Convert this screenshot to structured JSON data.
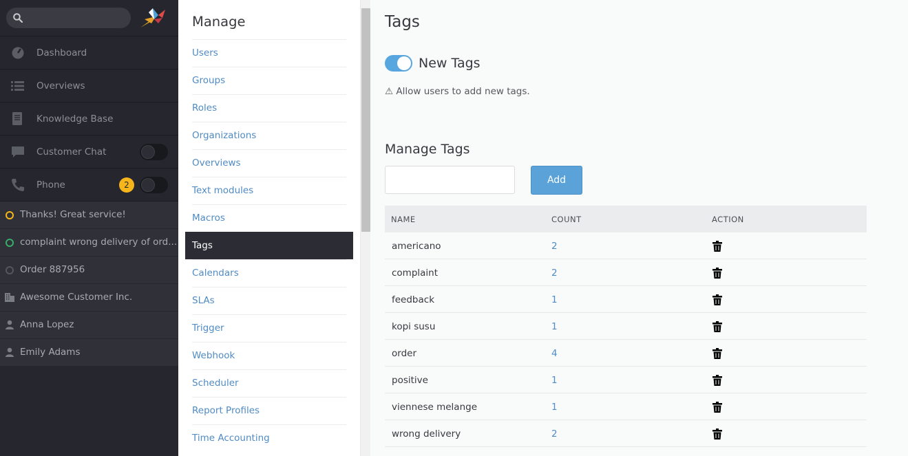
{
  "nav": {
    "items": [
      {
        "label": "Dashboard",
        "icon": "dashboard-icon"
      },
      {
        "label": "Overviews",
        "icon": "list-icon"
      },
      {
        "label": "Knowledge Base",
        "icon": "book-icon"
      },
      {
        "label": "Customer Chat",
        "icon": "chat-icon"
      },
      {
        "label": "Phone",
        "icon": "phone-icon",
        "badge": "2"
      }
    ],
    "tasks": [
      {
        "label": "Thanks! Great service!",
        "dot_color": "#f6b61b"
      },
      {
        "label": "complaint wrong delivery of ord...",
        "dot_color": "#38ad69"
      },
      {
        "label": "Order 887956",
        "dot_color": "#55575c"
      },
      {
        "label": "Awesome Customer Inc.",
        "icon": "organization-icon"
      },
      {
        "label": "Anna Lopez",
        "icon": "user-icon"
      },
      {
        "label": "Emily Adams",
        "icon": "user-icon"
      }
    ]
  },
  "manage": {
    "title": "Manage",
    "items": [
      "Users",
      "Groups",
      "Roles",
      "Organizations",
      "Overviews",
      "Text modules",
      "Macros",
      "Tags",
      "Calendars",
      "SLAs",
      "Trigger",
      "Webhook",
      "Scheduler",
      "Report Profiles",
      "Time Accounting"
    ],
    "active": "Tags"
  },
  "main": {
    "title": "Tags",
    "new_tags_label": "New Tags",
    "new_tags_enabled": true,
    "hint": "⚠ Allow users to add new tags.",
    "manage_title": "Manage Tags",
    "add_label": "Add",
    "columns": [
      "NAME",
      "COUNT",
      "ACTION"
    ],
    "rows": [
      {
        "name": "americano",
        "count": "2"
      },
      {
        "name": "complaint",
        "count": "2"
      },
      {
        "name": "feedback",
        "count": "1"
      },
      {
        "name": "kopi susu",
        "count": "1"
      },
      {
        "name": "order",
        "count": "4"
      },
      {
        "name": "positive",
        "count": "1"
      },
      {
        "name": "viennese melange",
        "count": "1"
      },
      {
        "name": "wrong delivery",
        "count": "2"
      }
    ]
  },
  "colors": {
    "accent": "#58a6df",
    "link": "#4f8bc5",
    "nav_bg": "#26272e",
    "badge": "#f6b61b"
  }
}
